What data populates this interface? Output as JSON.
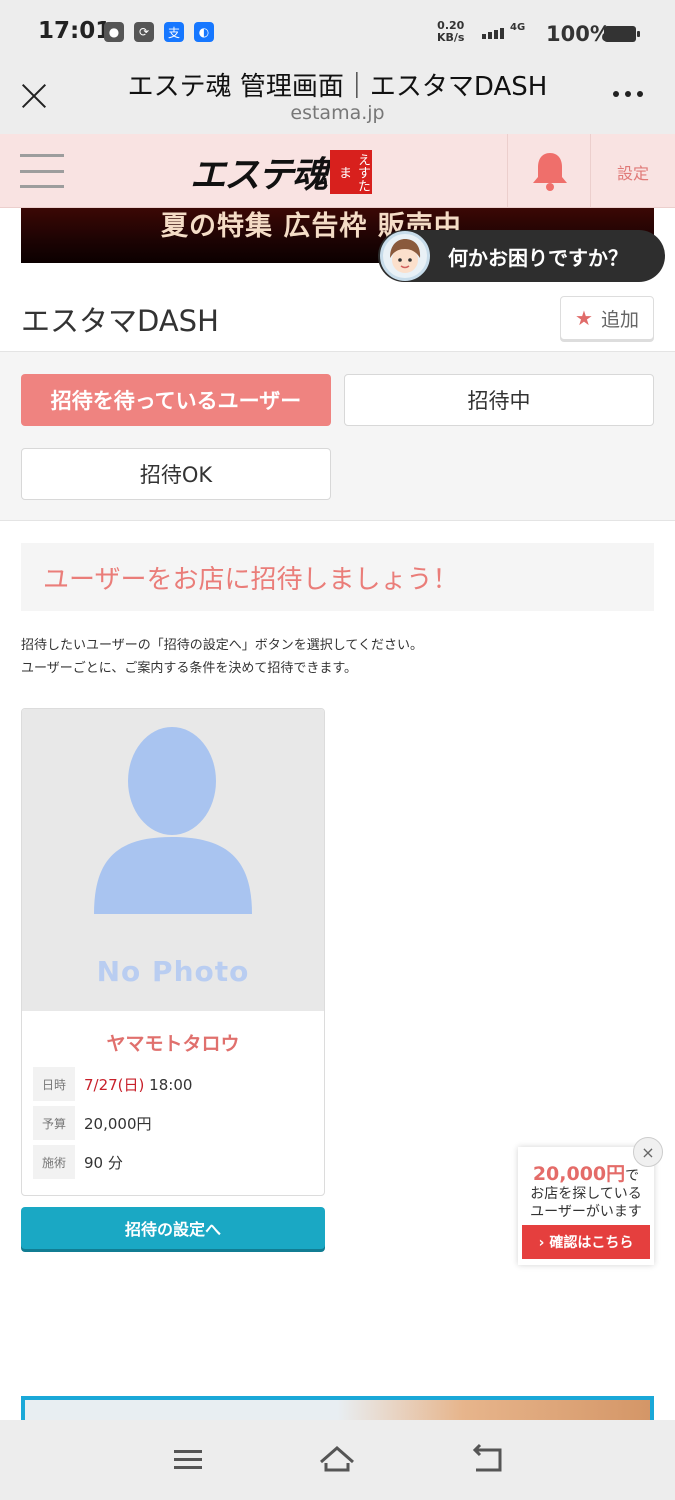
{
  "status_bar": {
    "time": "17:01",
    "speed_value": "0.20",
    "speed_unit": "KB/s",
    "network": "4G",
    "battery": "100%"
  },
  "browser": {
    "title": "エステ魂 管理画面｜エスタマDASH",
    "domain": "estama.jp"
  },
  "site_header": {
    "logo_text": "エステ魂",
    "logo_stamp": "えすたま",
    "settings_label": "設定"
  },
  "banner": {
    "text": "夏の特集 広告枠 販売中"
  },
  "help": {
    "text": "何かお困りですか？"
  },
  "page": {
    "title": "エスタマDASH",
    "add_label": "追加"
  },
  "tabs": [
    {
      "label": "招待を待っているユーザー",
      "active": true
    },
    {
      "label": "招待中",
      "active": false
    },
    {
      "label": "招待OK",
      "active": false
    }
  ],
  "invite": {
    "heading": "ユーザーをお店に招待しましょう！",
    "desc_line1": "招待したいユーザーの「招待の設定へ」ボタンを選択してください。",
    "desc_line2": "ユーザーごとに、ご案内する条件を決めて招待できます。"
  },
  "user_card": {
    "photo_placeholder": "No Photo",
    "name": "ヤマモトタロウ",
    "date_label": "日時",
    "date": "7/27(日)",
    "time": "18:00",
    "budget_label": "予算",
    "budget": "20,000円",
    "course_label": "施術",
    "course": "90 分",
    "button": "招待の設定へ"
  },
  "promo": {
    "amount": "20,000円",
    "amount_suffix": "で",
    "line1": "お店を探している",
    "line2": "ユーザーがいます",
    "button": "› 確認はこちら",
    "close": "×"
  },
  "colors": {
    "accent_pink": "#ef8380",
    "header_bg": "#f9e3e2",
    "button_teal": "#1aa8c4",
    "promo_red": "#e53f3e"
  }
}
